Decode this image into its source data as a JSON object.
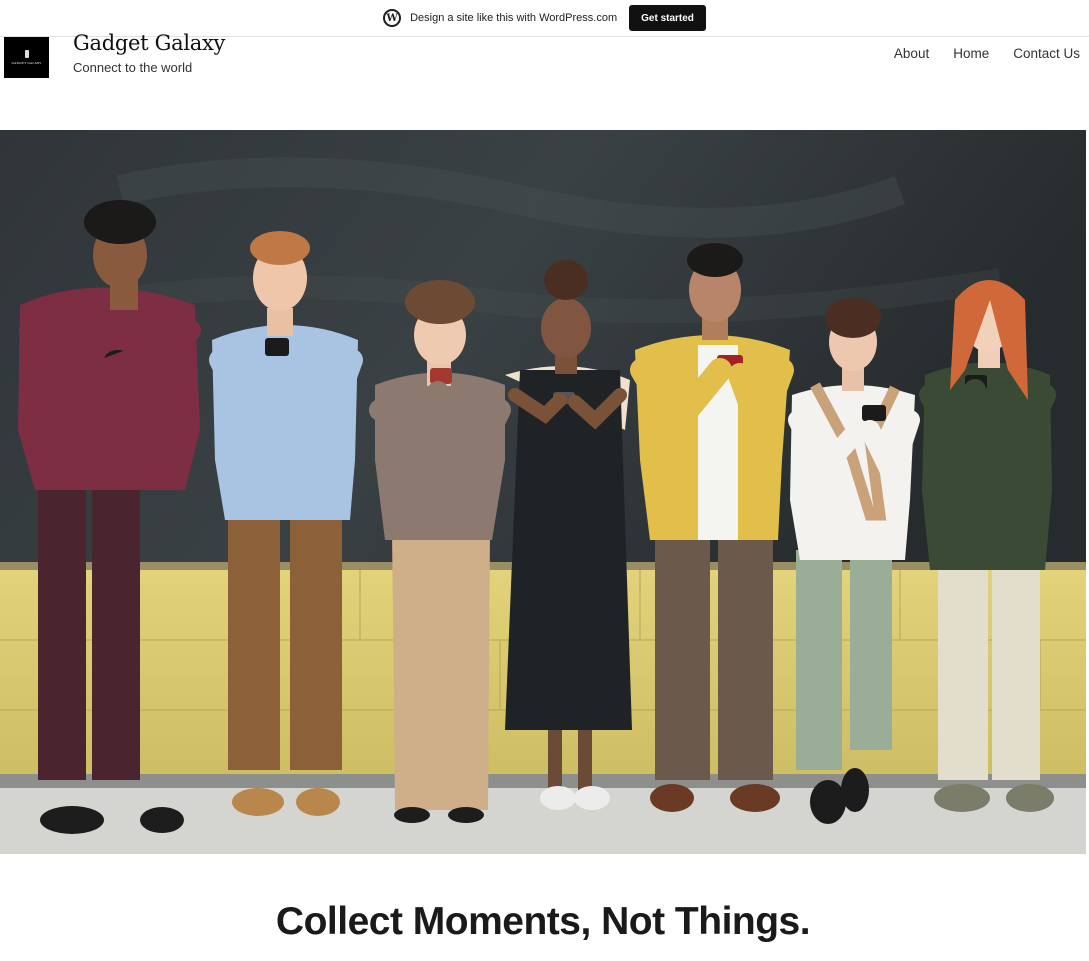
{
  "promo": {
    "text": "Design a site like this with WordPress.com",
    "button": "Get started"
  },
  "site": {
    "title": "Gadget Galaxy",
    "tagline": "Connect to the world",
    "logo_text": "GADGET GALAXY"
  },
  "nav": {
    "items": [
      "About",
      "Home",
      "Contact Us"
    ]
  },
  "hero": {
    "image": "photo of seven people standing against a chalkboard wall looking at smartphones"
  },
  "headline": "Collect Moments, Not Things.",
  "colors": {
    "chalkboard": "#2c3235",
    "wall_yellow": "#dccb6e",
    "floor": "#cfd0cc",
    "button_bg": "#111111"
  }
}
